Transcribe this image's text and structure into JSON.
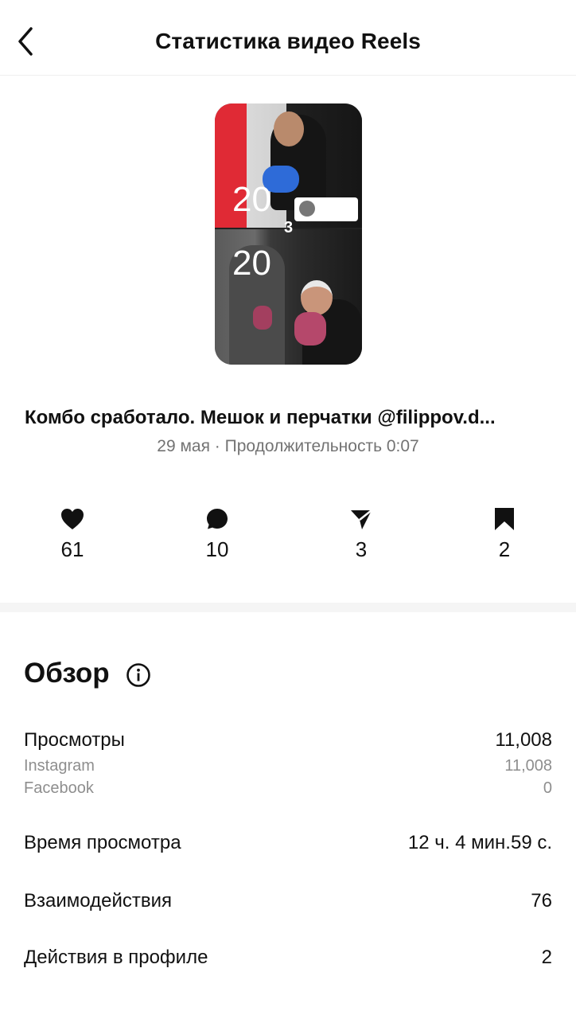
{
  "header": {
    "title": "Статистика видео Reels"
  },
  "thumbnail": {
    "overlay_top": "20",
    "overlay_bottom": "20",
    "overlay_mid": "3"
  },
  "post": {
    "caption": "Комбо сработало. Мешок и перчатки @filippov.d...",
    "meta": "29 мая · Продолжительность 0:07"
  },
  "stats": [
    {
      "icon": "heart-icon",
      "value": "61"
    },
    {
      "icon": "comment-icon",
      "value": "10"
    },
    {
      "icon": "share-icon",
      "value": "3"
    },
    {
      "icon": "bookmark-icon",
      "value": "2"
    }
  ],
  "overview": {
    "title": "Обзор",
    "views_label": "Просмотры",
    "views_value": "11,008",
    "instagram_label": "Instagram",
    "instagram_value": "11,008",
    "facebook_label": "Facebook",
    "facebook_value": "0",
    "watch_time_label": "Время просмотра",
    "watch_time_value": "12 ч. 4 мин.59 с.",
    "interactions_label": "Взаимодействия",
    "interactions_value": "76",
    "profile_actions_label": "Действия в профиле",
    "profile_actions_value": "2"
  }
}
